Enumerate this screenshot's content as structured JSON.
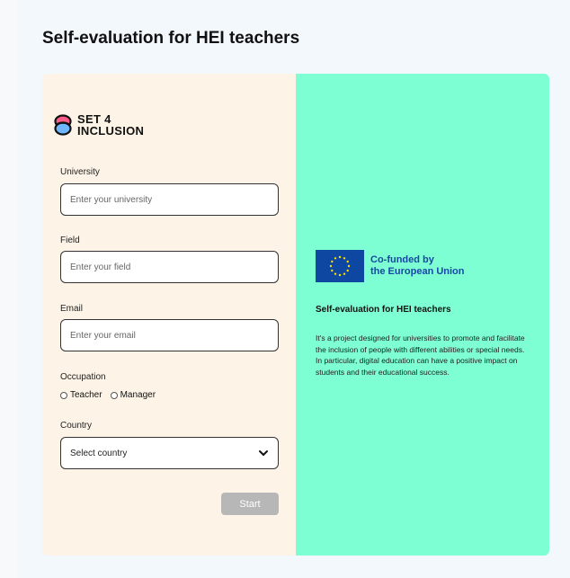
{
  "page": {
    "title": "Self-evaluation for HEI teachers"
  },
  "logo": {
    "line1": "SET 4",
    "line2": "INCLUSION"
  },
  "form": {
    "university": {
      "label": "University",
      "placeholder": "Enter your university"
    },
    "field": {
      "label": "Field",
      "placeholder": "Enter your field"
    },
    "email": {
      "label": "Email",
      "placeholder": "Enter your email"
    },
    "occupation": {
      "label": "Occupation",
      "options": [
        "Teacher",
        "Manager"
      ]
    },
    "country": {
      "label": "Country",
      "selected": "Select country"
    },
    "start_label": "Start"
  },
  "info": {
    "eu_line1": "Co-funded by",
    "eu_line2": "the European Union",
    "title": "Self-evaluation for HEI teachers",
    "description": "It's a project designed for universities to promote and facilitate the inclusion of people with different abilities or special needs. In particular, digital education can have a positive impact on students and their educational success."
  },
  "colors": {
    "left_panel": "#fdf4e7",
    "right_panel": "#7dffd3",
    "eu_blue": "#0e47a1",
    "eu_star": "#ffdd00",
    "eu_text": "#1947a5",
    "button_disabled": "#b7b7b7"
  }
}
